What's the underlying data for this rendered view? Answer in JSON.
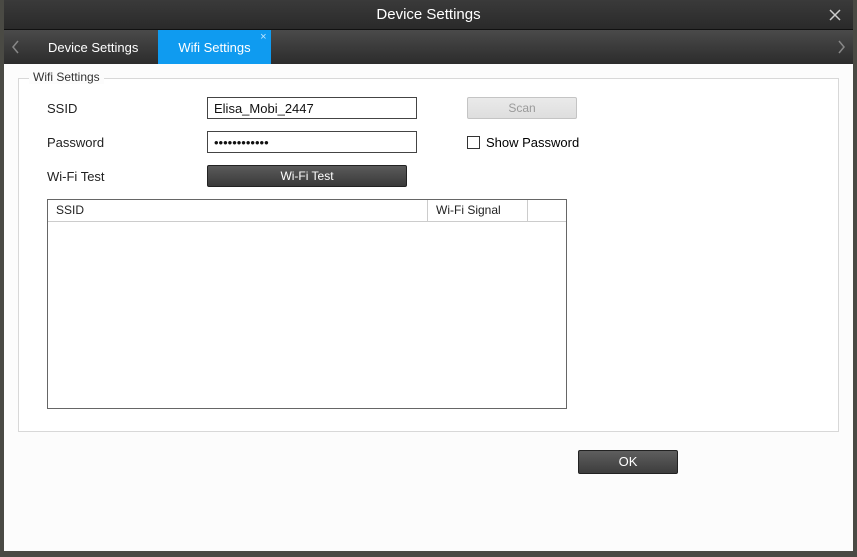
{
  "title": "Device Settings",
  "tabs": [
    {
      "label": "Device Settings",
      "active": false
    },
    {
      "label": "Wifi Settings",
      "active": true
    }
  ],
  "fieldset_legend": "Wifi Settings",
  "labels": {
    "ssid": "SSID",
    "password": "Password",
    "wifi_test": "Wi-Fi Test"
  },
  "inputs": {
    "ssid_value": "Elisa_Mobi_2447",
    "password_value": "••••••••••••"
  },
  "buttons": {
    "scan": "Scan",
    "wifi_test": "Wi-Fi Test",
    "ok": "OK"
  },
  "show_password_label": "Show Password",
  "show_password_checked": false,
  "table": {
    "columns": {
      "ssid": "SSID",
      "signal": "Wi-Fi Signal"
    },
    "rows": []
  }
}
